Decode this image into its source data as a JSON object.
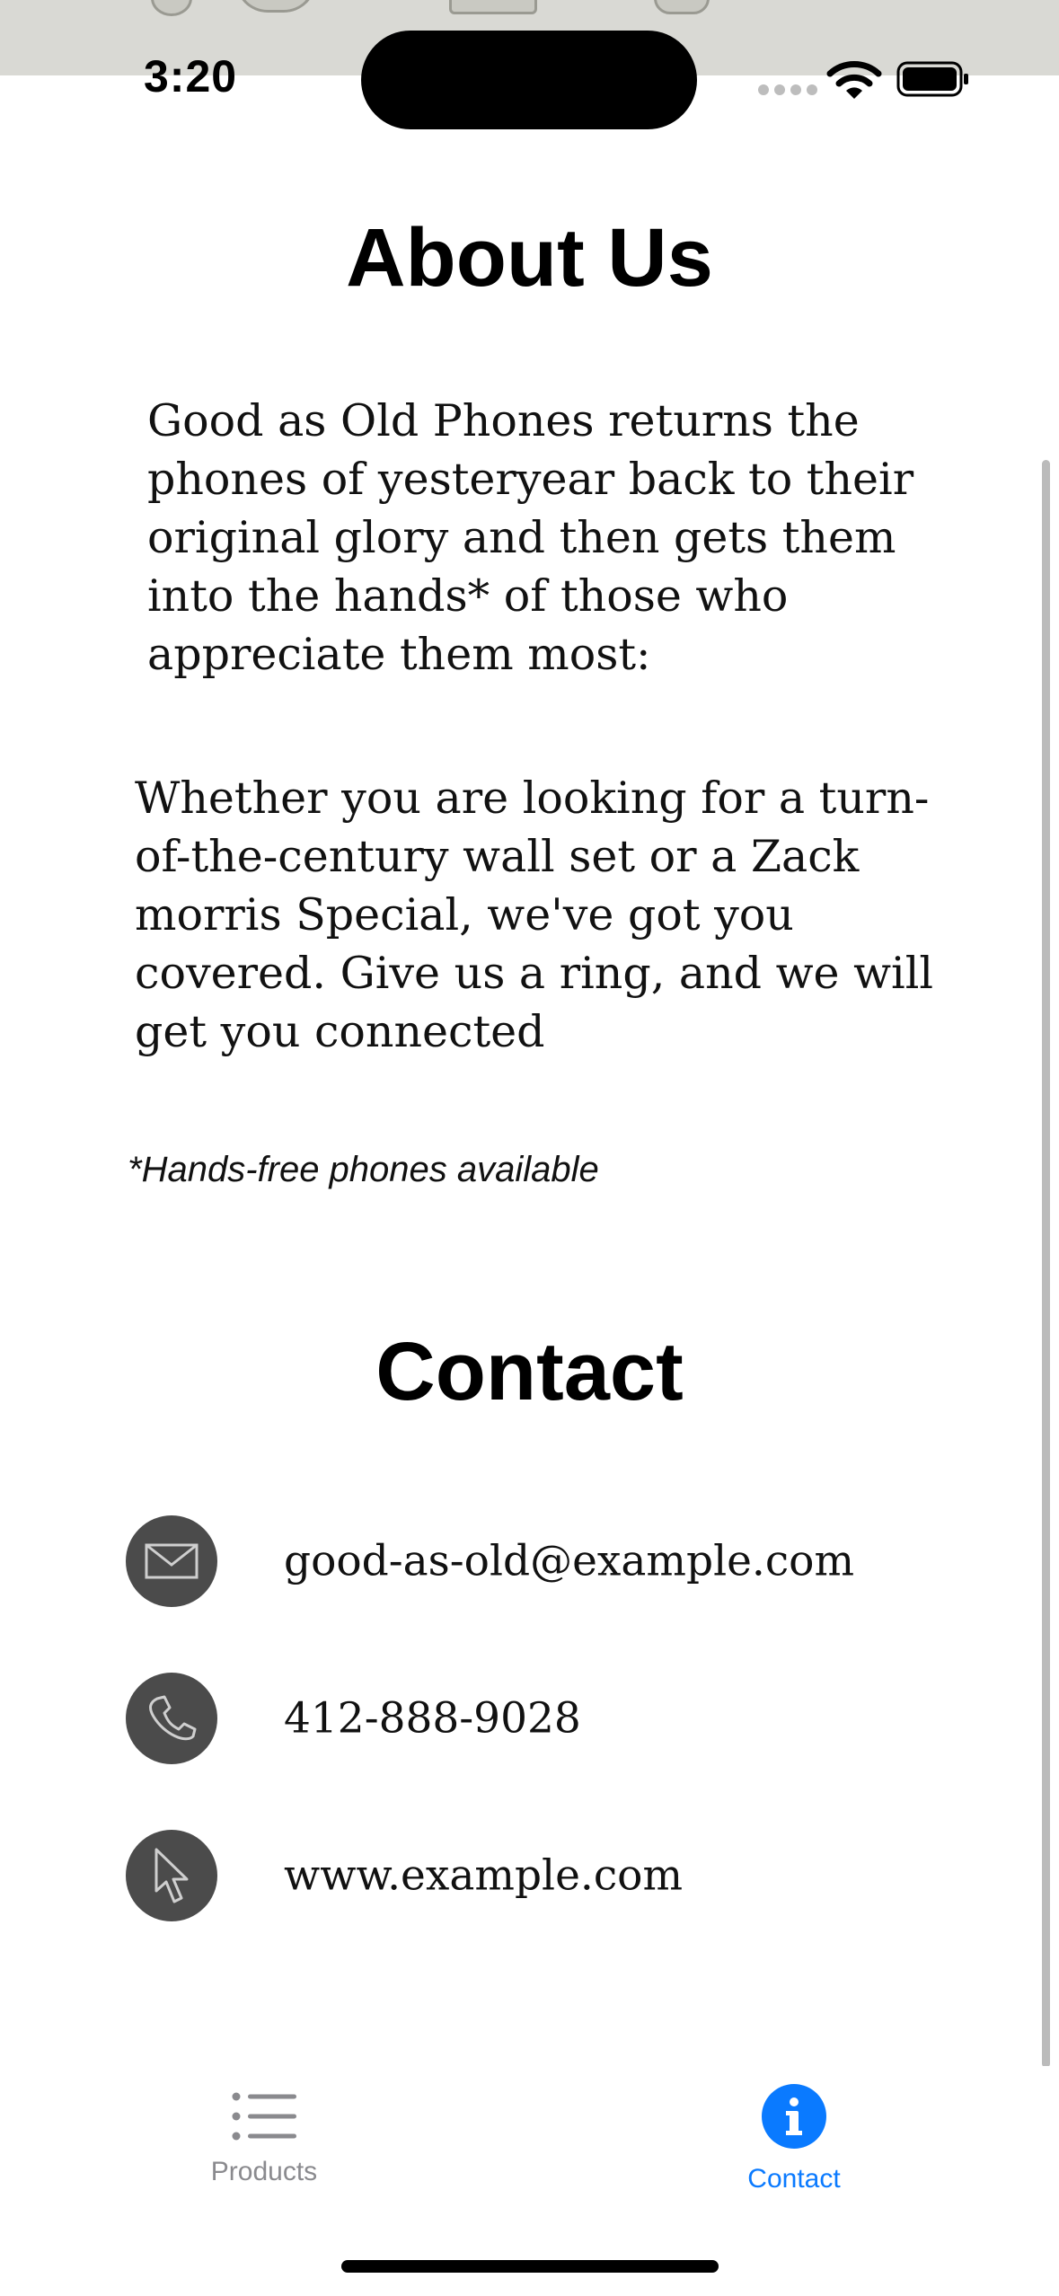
{
  "status_bar": {
    "time": "3:20"
  },
  "about": {
    "title": "About Us",
    "paragraph1": "Good as Old Phones returns the phones of yesteryear back to their original glory and then gets them into the hands* of those who appreciate them most:",
    "paragraph2": "Whether you are looking for a turn-of-the-century wall set or a Zack morris Special, we've got you covered. Give us a ring, and we will get you connected",
    "footnote": "*Hands-free phones available"
  },
  "contact": {
    "title": "Contact",
    "items": [
      {
        "icon": "envelope-icon",
        "text": "good-as-old@example.com"
      },
      {
        "icon": "phone-icon",
        "text": "412-888-9028"
      },
      {
        "icon": "cursor-icon",
        "text": "www.example.com"
      }
    ]
  },
  "tab_bar": {
    "tabs": [
      {
        "label": "Products",
        "icon": "list-icon",
        "selected": false
      },
      {
        "label": "Contact",
        "icon": "info-icon",
        "selected": true
      }
    ]
  },
  "colors": {
    "accent": "#0a7aff",
    "icon_circle": "#4b4b4b",
    "tab_inactive": "#8a8a8e"
  }
}
